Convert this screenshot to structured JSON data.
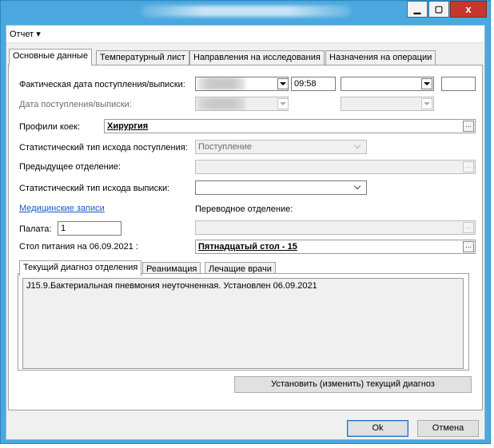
{
  "window": {
    "min_icon": "minimize-icon",
    "max_icon": "maximize-icon",
    "close_icon": "close-icon",
    "min_glyph": "▁",
    "max_glyph": "▢",
    "close_glyph": "x"
  },
  "menu": {
    "report": "Отчет",
    "arrow_glyph": "▾"
  },
  "tabs": [
    {
      "label": "Основные данные",
      "active": true
    },
    {
      "label": "Температурный лист"
    },
    {
      "label": "Направления на исследования"
    },
    {
      "label": "Назначения на операции"
    }
  ],
  "form": {
    "actual_date_label": "Фактическая дата поступления/выписки:",
    "actual_time": "09:58",
    "date_label": "Дата поступления/выписки:",
    "bed_profiles_label": "Профили коек:",
    "bed_profiles_value": "Хирургия",
    "stat_admission_label": "Статистический тип исхода поступления:",
    "stat_admission_value": "Поступление",
    "prev_department_label": "Предыдущее отделение:",
    "stat_discharge_label": "Статистический тип исхода выписки:",
    "medical_records_link": "Медицинские записи",
    "transfer_department_label": "Переводное отделение:",
    "ward_label": "Палата:",
    "ward_value": "1",
    "diet_label": "Стол питания на 06.09.2021 :",
    "diet_value": "Пятнадцатый стол - 15",
    "dots_glyph": "..."
  },
  "subtabs": [
    {
      "label": "Текущий диагноз отделения",
      "active": true
    },
    {
      "label": "Реанимация"
    },
    {
      "label": "Лечащие врачи"
    }
  ],
  "diagnosis": {
    "text": "J15.9.Бактериальная пневмония неуточненная. Установлен 06.09.2021",
    "set_button": "Установить (изменить) текущий диагноз"
  },
  "footer": {
    "ok": "Ok",
    "cancel": "Отмена"
  }
}
